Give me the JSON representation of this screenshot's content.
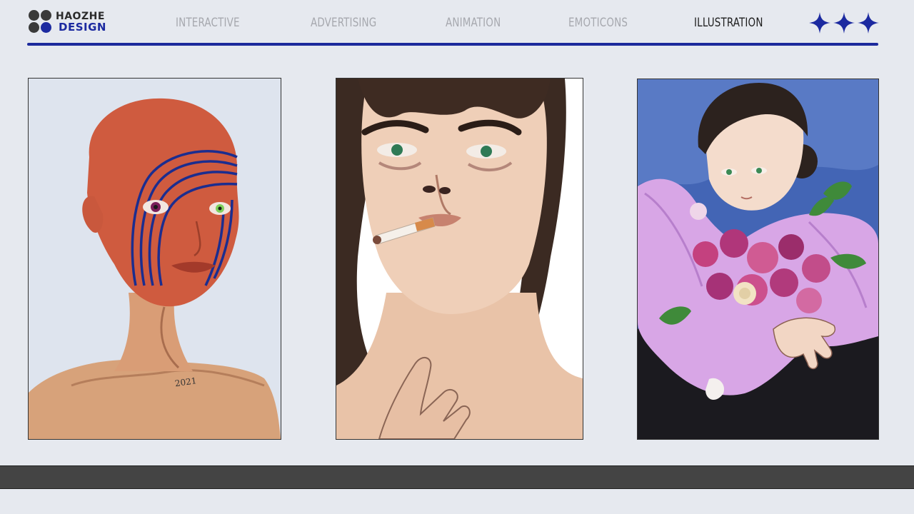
{
  "brand": {
    "line1": "HAOZHE",
    "line2": "DESIGN",
    "dot_colors": [
      "#3a3a3a",
      "#3a3a3a",
      "#3a3a3a",
      "#1c2aa0"
    ],
    "accent": "#1c2a9c"
  },
  "nav": {
    "items": [
      {
        "label": "INTERACTIVE",
        "active": false
      },
      {
        "label": "ADVERTISING",
        "active": false
      },
      {
        "label": "ANIMATION",
        "active": false
      },
      {
        "label": "EMOTICONS",
        "active": false
      },
      {
        "label": "ILLUSTRATION",
        "active": true
      }
    ],
    "inactive_color": "#a6a8ae",
    "active_color": "#1e1e1e"
  },
  "decor": {
    "star_count": 3,
    "star_color": "#1c2aa0"
  },
  "gallery": {
    "illustrations": [
      {
        "name": "bald-figure-portrait",
        "signature": "2021"
      },
      {
        "name": "smoking-man-portrait"
      },
      {
        "name": "bouquet-figure-portrait"
      }
    ]
  }
}
